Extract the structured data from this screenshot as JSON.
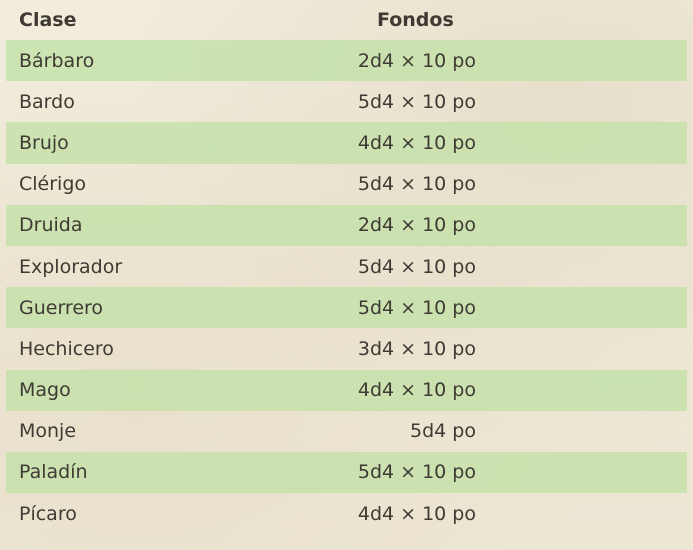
{
  "table": {
    "headers": {
      "class": "Clase",
      "funds": "Fondos"
    },
    "rows": [
      {
        "class": "Bárbaro",
        "funds": "2d4 × 10 po"
      },
      {
        "class": "Bardo",
        "funds": "5d4 × 10 po"
      },
      {
        "class": "Brujo",
        "funds": "4d4 × 10 po"
      },
      {
        "class": "Clérigo",
        "funds": "5d4 × 10 po"
      },
      {
        "class": "Druida",
        "funds": "2d4 × 10 po"
      },
      {
        "class": "Explorador",
        "funds": "5d4 × 10 po"
      },
      {
        "class": "Guerrero",
        "funds": "5d4 × 10 po"
      },
      {
        "class": "Hechicero",
        "funds": "3d4 × 10 po"
      },
      {
        "class": "Mago",
        "funds": "4d4 × 10 po"
      },
      {
        "class": "Monje",
        "funds": "5d4 po"
      },
      {
        "class": "Paladín",
        "funds": "5d4 × 10 po"
      },
      {
        "class": "Pícaro",
        "funds": "4d4 × 10 po"
      }
    ]
  },
  "colors": {
    "shaded_row": "#c6e2aa",
    "text": "#3f3a33",
    "background": "#efe9d8"
  }
}
